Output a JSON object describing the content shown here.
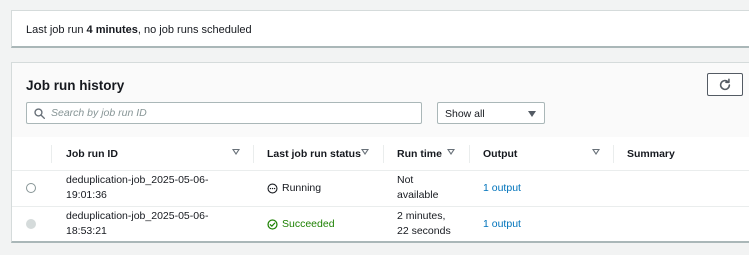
{
  "banner": {
    "prefix": "Last job run ",
    "emphasis": "4 minutes",
    "suffix": ", no job runs scheduled"
  },
  "panel": {
    "title": "Job run history",
    "refresh_icon": "refresh-icon"
  },
  "search": {
    "placeholder": "Search by job run ID",
    "value": "",
    "icon": "search-icon"
  },
  "filter": {
    "selected": "Show all"
  },
  "table": {
    "columns": [
      {
        "label": "Job run ID",
        "sortable": true
      },
      {
        "label": "Last job run status",
        "sortable": true
      },
      {
        "label": "Run time",
        "sortable": true
      },
      {
        "label": "Output",
        "sortable": true
      },
      {
        "label": "Summary",
        "sortable": false
      }
    ],
    "rows": [
      {
        "id_line1": "deduplication-job_2025-05-06-",
        "id_line2": "19:01:36",
        "status": "Running",
        "status_icon": "running-icon",
        "runtime_line1": "Not",
        "runtime_line2": "available",
        "output": "1 output",
        "summary": "",
        "radio_enabled": true
      },
      {
        "id_line1": "deduplication-job_2025-05-06-",
        "id_line2": "18:53:21",
        "status": "Succeeded",
        "status_icon": "success-check-icon",
        "runtime_line1": "2 minutes,",
        "runtime_line2": "22 seconds",
        "output": "1 output",
        "summary": "",
        "radio_enabled": false
      }
    ]
  },
  "colors": {
    "link": "#0073bb",
    "success": "#1d8102",
    "border": "#d5dbdb"
  }
}
